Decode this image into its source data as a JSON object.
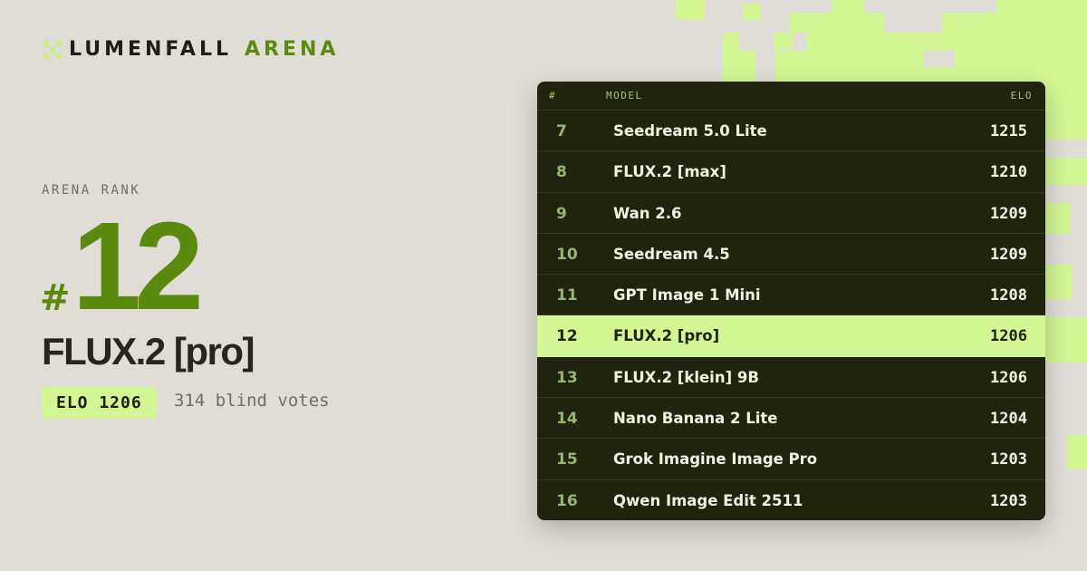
{
  "brand": {
    "name": "LUMENFALL",
    "accent": "ARENA",
    "icon": "pixel-cross-icon"
  },
  "rank_label": "ARENA RANK",
  "rank_hash": "#",
  "rank": "12",
  "model_name": "FLUX.2 [pro]",
  "elo_badge": "ELO 1206",
  "votes": "314 blind votes",
  "colors": {
    "accent_green": "#5c8a0e",
    "highlight_lime": "#d3f593",
    "board_bg": "#20240f",
    "page_bg": "#e0ddd7"
  },
  "leaderboard": {
    "headers": {
      "rank": "#",
      "model": "MODEL",
      "elo": "ELO"
    },
    "rows": [
      {
        "rank": "7",
        "model": "Seedream 5.0 Lite",
        "elo": "1215"
      },
      {
        "rank": "8",
        "model": "FLUX.2 [max]",
        "elo": "1210"
      },
      {
        "rank": "9",
        "model": "Wan 2.6",
        "elo": "1209"
      },
      {
        "rank": "10",
        "model": "Seedream 4.5",
        "elo": "1209"
      },
      {
        "rank": "11",
        "model": "GPT Image 1 Mini",
        "elo": "1208"
      },
      {
        "rank": "12",
        "model": "FLUX.2 [pro]",
        "elo": "1206",
        "highlighted": true
      },
      {
        "rank": "13",
        "model": "FLUX.2 [klein] 9B",
        "elo": "1206"
      },
      {
        "rank": "14",
        "model": "Nano Banana 2 Lite",
        "elo": "1204"
      },
      {
        "rank": "15",
        "model": "Grok Imagine Image Pro",
        "elo": "1203"
      },
      {
        "rank": "16",
        "model": "Qwen Image Edit 2511",
        "elo": "1203"
      }
    ]
  }
}
